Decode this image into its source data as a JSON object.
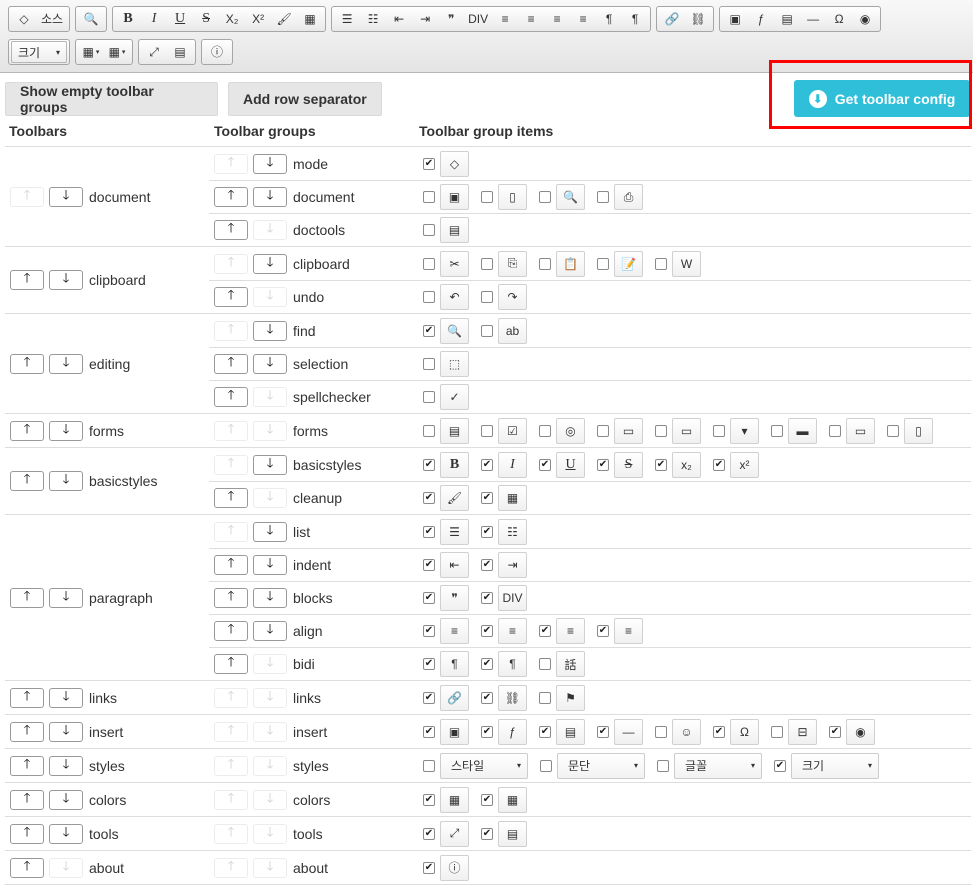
{
  "toolbar": {
    "rows": [
      [
        [
          {
            "glyph": "◇"
          },
          {
            "glyph": "소스"
          }
        ],
        [
          {
            "glyph": "🔍"
          }
        ],
        [
          {
            "glyph": "B",
            "style": "b"
          },
          {
            "glyph": "I",
            "style": "i"
          },
          {
            "glyph": "U",
            "style": "u"
          },
          {
            "glyph": "S",
            "style": "s"
          },
          {
            "glyph": "X₂"
          },
          {
            "glyph": "X²"
          },
          {
            "glyph": "🖌"
          },
          {
            "glyph": "▦"
          }
        ],
        [
          {
            "glyph": "☰"
          },
          {
            "glyph": "☷"
          },
          {
            "glyph": "⇤"
          },
          {
            "glyph": "⇥"
          },
          {
            "glyph": "❞"
          },
          {
            "glyph": "DIV"
          },
          {
            "glyph": "≡"
          },
          {
            "glyph": "≡"
          },
          {
            "glyph": "≡"
          },
          {
            "glyph": "≡"
          },
          {
            "glyph": "¶"
          },
          {
            "glyph": "¶"
          }
        ],
        [
          {
            "glyph": "🔗"
          },
          {
            "glyph": "⛓"
          }
        ],
        [
          {
            "glyph": "▣"
          },
          {
            "glyph": "ƒ"
          },
          {
            "glyph": "▤"
          },
          {
            "glyph": "―"
          },
          {
            "glyph": "Ω"
          },
          {
            "glyph": "◉"
          }
        ]
      ],
      [
        [
          {
            "combo": "크기"
          }
        ],
        [
          {
            "glyph": "▦",
            "split": true
          },
          {
            "glyph": "▦",
            "split": true
          }
        ],
        [
          {
            "glyph": "⤢"
          },
          {
            "glyph": "▤"
          }
        ],
        [
          {
            "glyph": "ⓘ"
          }
        ]
      ]
    ]
  },
  "buttons": {
    "show_empty": "Show empty toolbar groups",
    "add_row": "Add row separator",
    "get_config": "Get toolbar config",
    "get_config_icon": "⬇"
  },
  "headers": {
    "toolbars": "Toolbars",
    "groups": "Toolbar groups",
    "items": "Toolbar group items"
  },
  "toolbars": [
    {
      "name": "document",
      "up": false,
      "down": true,
      "groups": [
        {
          "name": "mode",
          "up": false,
          "down": true,
          "items": [
            {
              "c": true,
              "g": "◇"
            }
          ]
        },
        {
          "name": "document",
          "up": true,
          "down": true,
          "items": [
            {
              "c": false,
              "g": "▣"
            },
            {
              "c": false,
              "g": "▯"
            },
            {
              "c": false,
              "g": "🔍"
            },
            {
              "c": false,
              "g": "⎙"
            }
          ]
        },
        {
          "name": "doctools",
          "up": true,
          "down": false,
          "items": [
            {
              "c": false,
              "g": "▤"
            }
          ]
        }
      ]
    },
    {
      "name": "clipboard",
      "up": true,
      "down": true,
      "groups": [
        {
          "name": "clipboard",
          "up": false,
          "down": true,
          "items": [
            {
              "c": false,
              "g": "✂"
            },
            {
              "c": false,
              "g": "⎘"
            },
            {
              "c": false,
              "g": "📋"
            },
            {
              "c": false,
              "g": "📝"
            },
            {
              "c": false,
              "g": "W"
            }
          ]
        },
        {
          "name": "undo",
          "up": true,
          "down": false,
          "items": [
            {
              "c": false,
              "g": "↶"
            },
            {
              "c": false,
              "g": "↷"
            }
          ]
        }
      ]
    },
    {
      "name": "editing",
      "up": true,
      "down": true,
      "groups": [
        {
          "name": "find",
          "up": false,
          "down": true,
          "items": [
            {
              "c": true,
              "g": "🔍"
            },
            {
              "c": false,
              "g": "ab"
            }
          ]
        },
        {
          "name": "selection",
          "up": true,
          "down": true,
          "items": [
            {
              "c": false,
              "g": "⬚"
            }
          ]
        },
        {
          "name": "spellchecker",
          "up": true,
          "down": false,
          "items": [
            {
              "c": false,
              "g": "✓"
            }
          ]
        }
      ]
    },
    {
      "name": "forms",
      "up": true,
      "down": true,
      "groups": [
        {
          "name": "forms",
          "up": false,
          "down": false,
          "items": [
            {
              "c": false,
              "g": "▤"
            },
            {
              "c": false,
              "g": "☑"
            },
            {
              "c": false,
              "g": "◎"
            },
            {
              "c": false,
              "g": "▭"
            },
            {
              "c": false,
              "g": "▭"
            },
            {
              "c": false,
              "g": "▾"
            },
            {
              "c": false,
              "g": "▬"
            },
            {
              "c": false,
              "g": "▭"
            },
            {
              "c": false,
              "g": "▯"
            }
          ]
        }
      ]
    },
    {
      "name": "basicstyles",
      "up": true,
      "down": true,
      "groups": [
        {
          "name": "basicstyles",
          "up": false,
          "down": true,
          "items": [
            {
              "c": true,
              "g": "B",
              "s": "b"
            },
            {
              "c": true,
              "g": "I",
              "s": "i"
            },
            {
              "c": true,
              "g": "U",
              "s": "u"
            },
            {
              "c": true,
              "g": "S",
              "s": "s"
            },
            {
              "c": true,
              "g": "x₂"
            },
            {
              "c": true,
              "g": "x²"
            }
          ]
        },
        {
          "name": "cleanup",
          "up": true,
          "down": false,
          "items": [
            {
              "c": true,
              "g": "🖌"
            },
            {
              "c": true,
              "g": "▦"
            }
          ]
        }
      ]
    },
    {
      "name": "paragraph",
      "up": true,
      "down": true,
      "groups": [
        {
          "name": "list",
          "up": false,
          "down": true,
          "items": [
            {
              "c": true,
              "g": "☰"
            },
            {
              "c": true,
              "g": "☷"
            }
          ]
        },
        {
          "name": "indent",
          "up": true,
          "down": true,
          "items": [
            {
              "c": true,
              "g": "⇤"
            },
            {
              "c": true,
              "g": "⇥"
            }
          ]
        },
        {
          "name": "blocks",
          "up": true,
          "down": true,
          "items": [
            {
              "c": true,
              "g": "❞"
            },
            {
              "c": true,
              "g": "DIV"
            }
          ]
        },
        {
          "name": "align",
          "up": true,
          "down": true,
          "items": [
            {
              "c": true,
              "g": "≡"
            },
            {
              "c": true,
              "g": "≡"
            },
            {
              "c": true,
              "g": "≡"
            },
            {
              "c": true,
              "g": "≡"
            }
          ]
        },
        {
          "name": "bidi",
          "up": true,
          "down": false,
          "items": [
            {
              "c": true,
              "g": "¶"
            },
            {
              "c": true,
              "g": "¶"
            },
            {
              "c": false,
              "g": "話"
            }
          ]
        }
      ]
    },
    {
      "name": "links",
      "up": true,
      "down": true,
      "groups": [
        {
          "name": "links",
          "up": false,
          "down": false,
          "items": [
            {
              "c": true,
              "g": "🔗"
            },
            {
              "c": true,
              "g": "⛓"
            },
            {
              "c": false,
              "g": "⚑"
            }
          ]
        }
      ]
    },
    {
      "name": "insert",
      "up": true,
      "down": true,
      "groups": [
        {
          "name": "insert",
          "up": false,
          "down": false,
          "items": [
            {
              "c": true,
              "g": "▣"
            },
            {
              "c": true,
              "g": "ƒ"
            },
            {
              "c": true,
              "g": "▤"
            },
            {
              "c": true,
              "g": "―"
            },
            {
              "c": false,
              "g": "☺"
            },
            {
              "c": true,
              "g": "Ω"
            },
            {
              "c": false,
              "g": "⊟"
            },
            {
              "c": true,
              "g": "◉"
            }
          ]
        }
      ]
    },
    {
      "name": "styles",
      "up": true,
      "down": true,
      "groups": [
        {
          "name": "styles",
          "up": false,
          "down": false,
          "items": [
            {
              "c": false,
              "dd": "스타일"
            },
            {
              "c": false,
              "dd": "문단"
            },
            {
              "c": false,
              "dd": "글꼴"
            },
            {
              "c": true,
              "dd": "크기"
            }
          ]
        }
      ]
    },
    {
      "name": "colors",
      "up": true,
      "down": true,
      "groups": [
        {
          "name": "colors",
          "up": false,
          "down": false,
          "items": [
            {
              "c": true,
              "g": "▦"
            },
            {
              "c": true,
              "g": "▦"
            }
          ]
        }
      ]
    },
    {
      "name": "tools",
      "up": true,
      "down": true,
      "groups": [
        {
          "name": "tools",
          "up": false,
          "down": false,
          "items": [
            {
              "c": true,
              "g": "⤢"
            },
            {
              "c": true,
              "g": "▤"
            }
          ]
        }
      ]
    },
    {
      "name": "about",
      "up": true,
      "down": false,
      "groups": [
        {
          "name": "about",
          "up": false,
          "down": false,
          "items": [
            {
              "c": true,
              "g": "ⓘ"
            }
          ]
        }
      ]
    }
  ],
  "glyphs": {
    "up": "🡑",
    "down": "🡓",
    "check": "✔",
    "caret": "▾"
  },
  "colors": {
    "accent": "#2fbfd9",
    "highlight": "#ff0000"
  }
}
